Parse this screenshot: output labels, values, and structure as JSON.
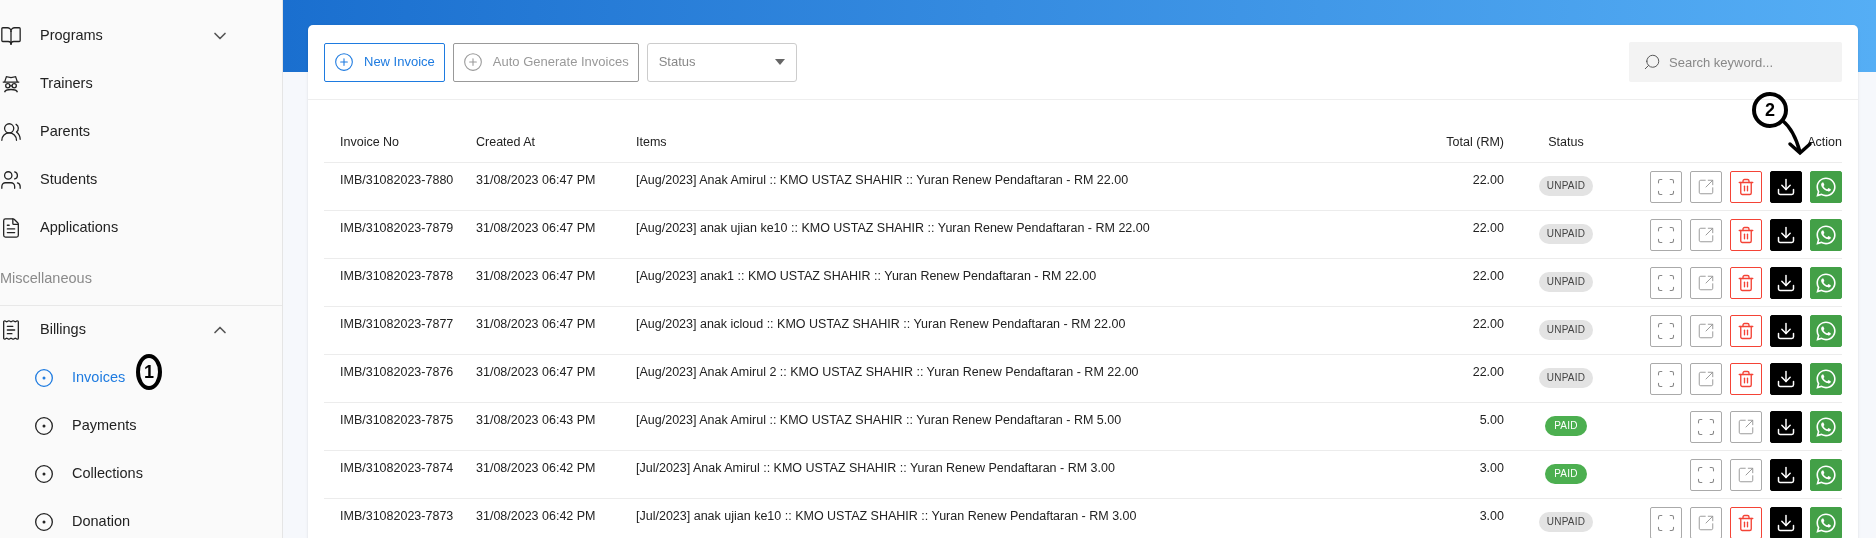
{
  "sidebar": {
    "entries": [
      {
        "kind": "item",
        "label": "Programs",
        "expanded": false
      },
      {
        "kind": "item",
        "label": "Trainers"
      },
      {
        "kind": "item",
        "label": "Parents"
      },
      {
        "kind": "item",
        "label": "Students"
      },
      {
        "kind": "item",
        "label": "Applications"
      },
      {
        "kind": "section",
        "label": "Miscellaneous"
      },
      {
        "kind": "item",
        "label": "Billings",
        "expanded": true,
        "children": [
          {
            "label": "Invoices",
            "selected": true
          },
          {
            "label": "Payments",
            "selected": false
          },
          {
            "label": "Collections",
            "selected": false
          },
          {
            "label": "Donation",
            "selected": false
          }
        ]
      }
    ]
  },
  "toolbar": {
    "new_button": "New Invoice",
    "auto_button": "Auto Generate Invoices",
    "status_select": {
      "placeholder": "Status"
    },
    "search": {
      "placeholder": "Search keyword..."
    }
  },
  "table": {
    "columns": [
      "Invoice No",
      "Created At",
      "Items",
      "Total (RM)",
      "Status",
      "Action"
    ],
    "rows": [
      {
        "invoice_no": "IMB/31082023-7880",
        "created_at": "31/08/2023 06:47 PM",
        "items": "[Aug/2023] Anak Amirul :: KMO USTAZ SHAHIR :: Yuran Renew Pendaftaran - RM 22.00",
        "total": "22.00",
        "status": {
          "kind": "unpaid",
          "label": "UNPAID"
        },
        "deletable": true
      },
      {
        "invoice_no": "IMB/31082023-7879",
        "created_at": "31/08/2023 06:47 PM",
        "items": "[Aug/2023] anak ujian ke10 :: KMO USTAZ SHAHIR :: Yuran Renew Pendaftaran - RM 22.00",
        "total": "22.00",
        "status": {
          "kind": "unpaid",
          "label": "UNPAID"
        },
        "deletable": true
      },
      {
        "invoice_no": "IMB/31082023-7878",
        "created_at": "31/08/2023 06:47 PM",
        "items": "[Aug/2023] anak1 :: KMO USTAZ SHAHIR :: Yuran Renew Pendaftaran - RM 22.00",
        "total": "22.00",
        "status": {
          "kind": "unpaid",
          "label": "UNPAID"
        },
        "deletable": true
      },
      {
        "invoice_no": "IMB/31082023-7877",
        "created_at": "31/08/2023 06:47 PM",
        "items": "[Aug/2023] anak icloud :: KMO USTAZ SHAHIR :: Yuran Renew Pendaftaran - RM 22.00",
        "total": "22.00",
        "status": {
          "kind": "unpaid",
          "label": "UNPAID"
        },
        "deletable": true
      },
      {
        "invoice_no": "IMB/31082023-7876",
        "created_at": "31/08/2023 06:47 PM",
        "items": "[Aug/2023] Anak Amirul 2 :: KMO USTAZ SHAHIR :: Yuran Renew Pendaftaran - RM 22.00",
        "total": "22.00",
        "status": {
          "kind": "unpaid",
          "label": "UNPAID"
        },
        "deletable": true
      },
      {
        "invoice_no": "IMB/31082023-7875",
        "created_at": "31/08/2023 06:43 PM",
        "items": "[Aug/2023] Anak Amirul :: KMO USTAZ SHAHIR :: Yuran Renew Pendaftaran - RM 5.00",
        "total": "5.00",
        "status": {
          "kind": "paid",
          "label": "PAID"
        },
        "deletable": false
      },
      {
        "invoice_no": "IMB/31082023-7874",
        "created_at": "31/08/2023 06:42 PM",
        "items": "[Jul/2023] Anak Amirul :: KMO USTAZ SHAHIR :: Yuran Renew Pendaftaran - RM 3.00",
        "total": "3.00",
        "status": {
          "kind": "paid",
          "label": "PAID"
        },
        "deletable": false
      },
      {
        "invoice_no": "IMB/31082023-7873",
        "created_at": "31/08/2023 06:42 PM",
        "items": "[Jul/2023] anak ujian ke10 :: KMO USTAZ SHAHIR :: Yuran Renew Pendaftaran - RM 3.00",
        "total": "3.00",
        "status": {
          "kind": "unpaid",
          "label": "UNPAID"
        },
        "deletable": true
      }
    ]
  },
  "annotations": [
    {
      "label": "1"
    },
    {
      "label": "2"
    }
  ]
}
